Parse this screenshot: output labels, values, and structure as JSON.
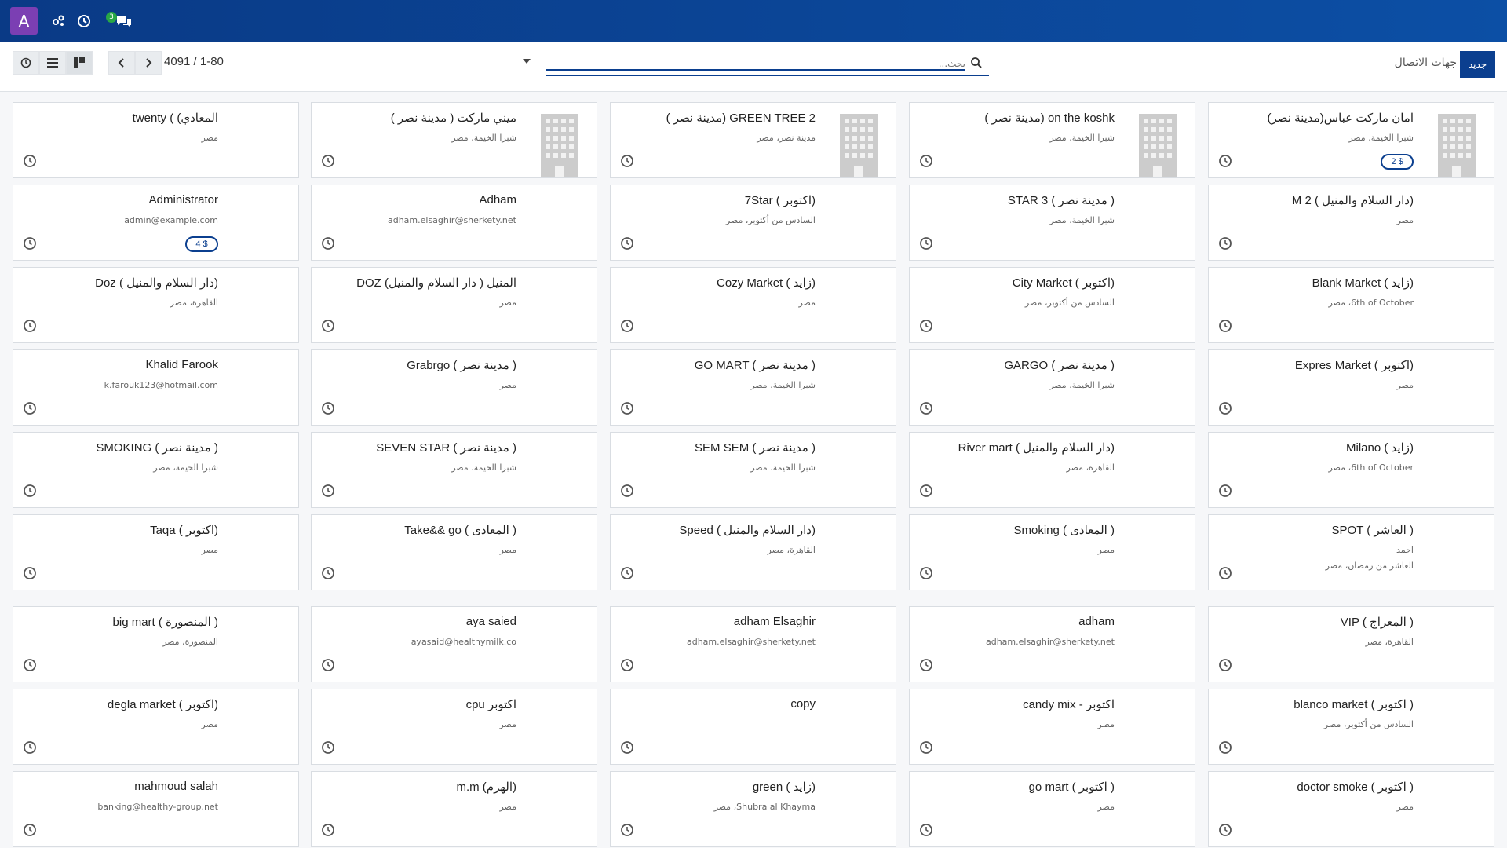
{
  "navbar": {
    "user_initial": "A",
    "messages_count": "3",
    "icons": [
      "activity-icon",
      "clock-icon",
      "chat-icon"
    ]
  },
  "control": {
    "pager_value": "4091 / 1-80",
    "search_placeholder": "بحث...",
    "breadcrumb": "جهات الاتصال",
    "new_button": "جديد"
  },
  "cards": [
    {
      "title": "(امان ماركت عباس(مدينة نصر",
      "sub": "شبرا الخيمة، مصر",
      "tag": "2 $",
      "image": true
    },
    {
      "title": "( مدينة نصر) on the koshk",
      "sub": "شبرا الخيمة، مصر",
      "image": true
    },
    {
      "title": "( مدينة نصر) GREEN TREE 2",
      "sub": "مدينة نصر، مصر",
      "image": true
    },
    {
      "title": "( ميني ماركت ( مدينة نصر",
      "sub": "شبرا الخيمة، مصر",
      "image": true
    },
    {
      "title": "twenty ( (المعادي",
      "sub": "مصر"
    },
    {
      "title": "M 2 ( دار السلام والمنيل)",
      "sub": "مصر"
    },
    {
      "title": "STAR 3 ( مدينة نصر )",
      "sub": "شبرا الخيمة، مصر"
    },
    {
      "title": "7Star ( اكتوبر)",
      "sub": "السادس من أكتوبر، مصر"
    },
    {
      "title": "Adham",
      "sub": "adham.elsaghir@sherkety.net"
    },
    {
      "title": "Administrator",
      "sub": "admin@example.com",
      "tag": "4 $"
    },
    {
      "title": "Blank Market ( زايد)",
      "sub": "6th of October، مصر"
    },
    {
      "title": "City Market ( اكتوبر)",
      "sub": "السادس من أكتوبر، مصر"
    },
    {
      "title": "Cozy Market ( زايد)",
      "sub": "مصر"
    },
    {
      "title": "DOZ المنيل ( دار السلام والمنيل)",
      "sub": "مصر"
    },
    {
      "title": "Doz ( دار السلام والمنيل)",
      "sub": "القاهرة، مصر"
    },
    {
      "title": "Expres Market ( اكتوبر)",
      "sub": "مصر"
    },
    {
      "title": "GARGO ( مدينة نصر )",
      "sub": "شبرا الخيمة، مصر"
    },
    {
      "title": "GO MART ( مدينة نصر )",
      "sub": "شبرا الخيمة، مصر"
    },
    {
      "title": "Grabrgo ( مدينة نصر )",
      "sub": "مصر"
    },
    {
      "title": "Khalid Farook",
      "sub": "k.farouk123@hotmail.com"
    },
    {
      "title": "Milano ( زايد)",
      "sub": "6th of October، مصر"
    },
    {
      "title": "River mart ( دار السلام والمنيل)",
      "sub": "القاهرة، مصر"
    },
    {
      "title": "SEM SEM ( مدينة نصر )",
      "sub": "شبرا الخيمة، مصر"
    },
    {
      "title": "SEVEN STAR ( مدينة نصر )",
      "sub": "شبرا الخيمة، مصر"
    },
    {
      "title": "SMOKING ( مدينة نصر )",
      "sub": "شبرا الخيمة، مصر"
    },
    {
      "title": "SPOT ( العاشر )",
      "sub": "احمد",
      "sub2": "العاشر من رمضان، مصر"
    },
    {
      "title": "Smoking ( المعادى )",
      "sub": "مصر"
    },
    {
      "title": "Speed ( دار السلام والمنيل)",
      "sub": "القاهرة، مصر"
    },
    {
      "title": "Take&& go ( المعادى )",
      "sub": "مصر"
    },
    {
      "title": "Taqa ( اكتوبر)",
      "sub": "مصر"
    },
    {
      "title": "VIP ( المعراج )",
      "sub": "القاهرة، مصر"
    },
    {
      "title": "adham",
      "sub": "adham.elsaghir@sherkety.net"
    },
    {
      "title": "adham Elsaghir",
      "sub": "adham.elsaghir@sherkety.net"
    },
    {
      "title": "aya saied",
      "sub": "ayasaid@healthymilk.co"
    },
    {
      "title": "big mart ( المنصورة )",
      "sub": "المنصورة، مصر"
    },
    {
      "title": "blanco market ( اكتوبر )",
      "sub": "السادس من أكتوبر، مصر"
    },
    {
      "title": "candy mix - اكتوبر",
      "sub": "مصر"
    },
    {
      "title": "copy",
      "sub": ""
    },
    {
      "title": "cpu اكتوبر",
      "sub": "مصر"
    },
    {
      "title": "degla market ( اكتوبر)",
      "sub": "مصر"
    },
    {
      "title": "doctor smoke ( اكتوبر )",
      "sub": "مصر"
    },
    {
      "title": "go mart ( اكتوبر )",
      "sub": "مصر"
    },
    {
      "title": "green ( زايد)",
      "sub": "Shubra al Khayma، مصر"
    },
    {
      "title": "m.m (الهرم)",
      "sub": "مصر"
    },
    {
      "title": "mahmoud salah",
      "sub": "banking@healthy-group.net"
    }
  ]
}
